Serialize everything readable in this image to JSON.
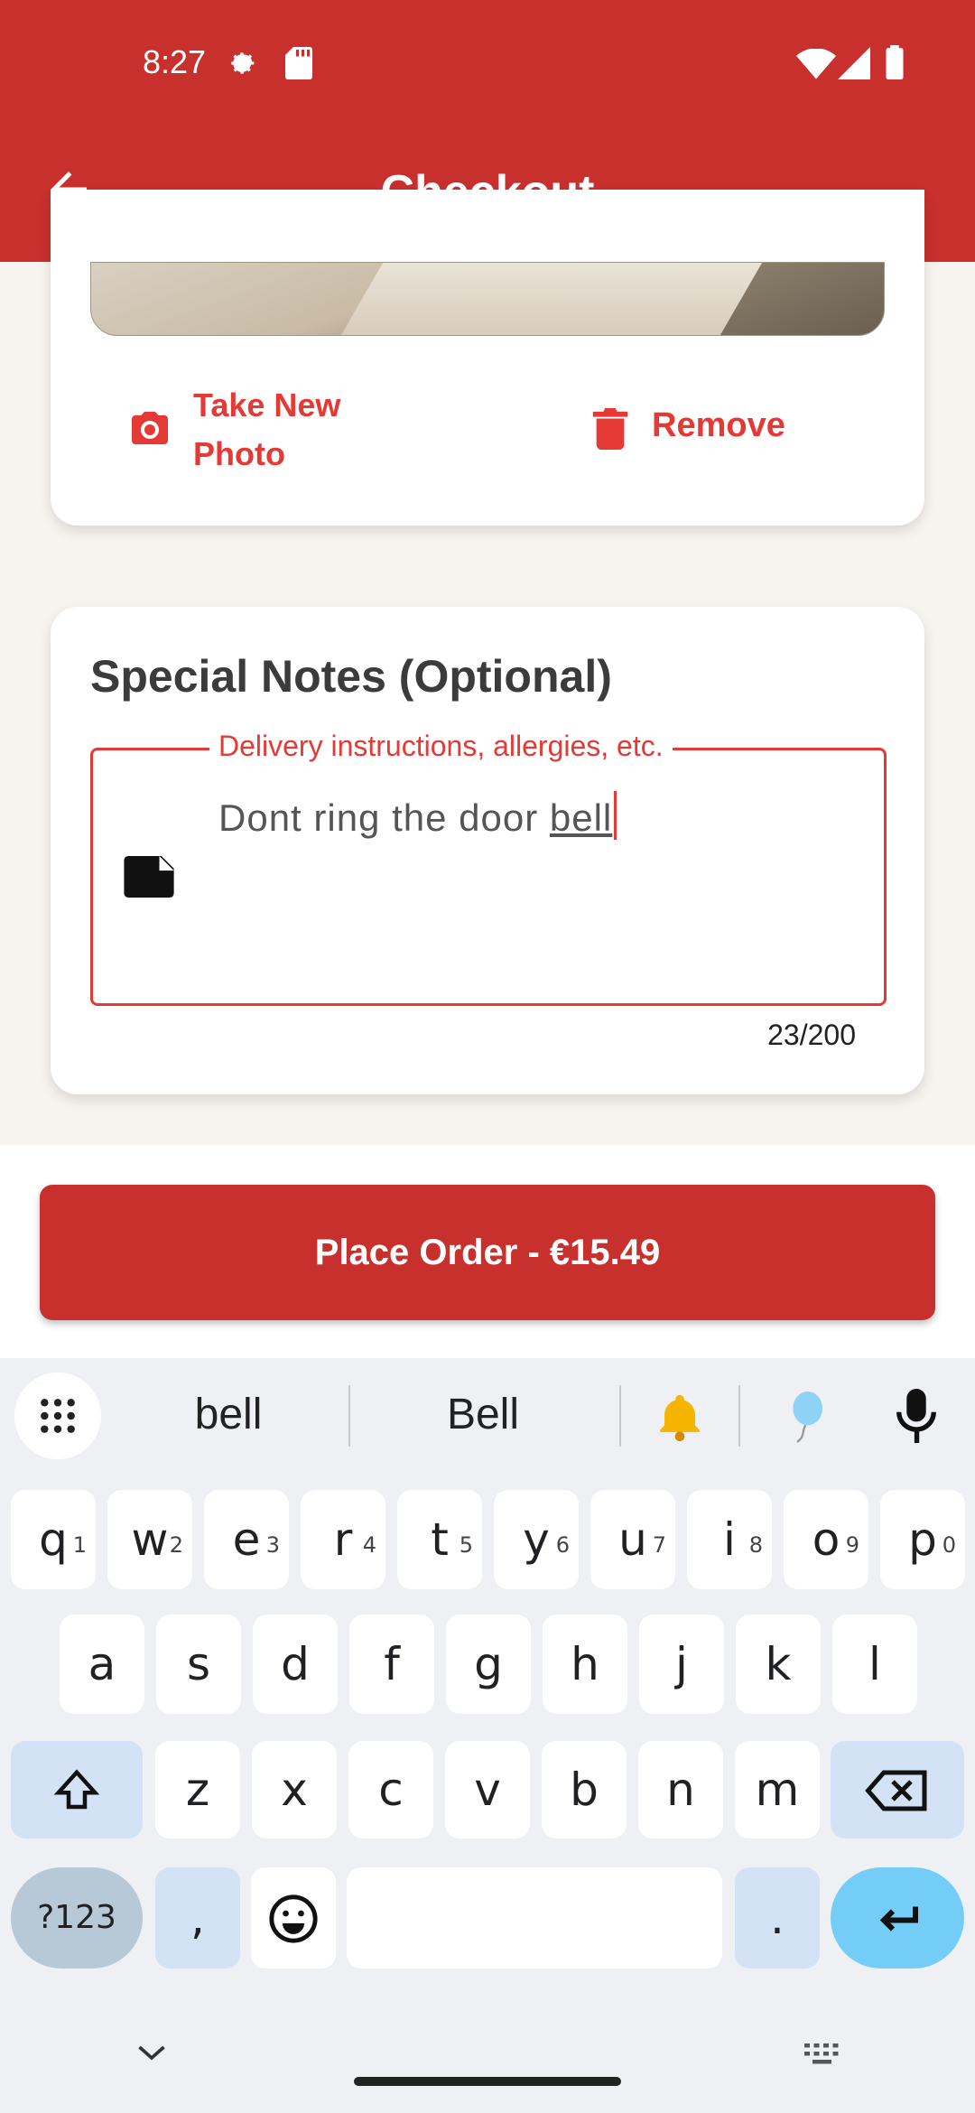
{
  "status_bar": {
    "time": "8:27"
  },
  "app_bar": {
    "title": "Checkout"
  },
  "photo_actions": {
    "take_photo": "Take New Photo",
    "remove": "Remove"
  },
  "notes": {
    "title": "Special Notes (Optional)",
    "label": "Delivery instructions, allergies, etc.",
    "value_prefix": "Dont ring the door ",
    "value_word": "bell",
    "counter": "23/200"
  },
  "order": {
    "button_label": "Place Order - €15.49"
  },
  "keyboard": {
    "suggestions": [
      "bell",
      "Bell"
    ],
    "row1": [
      {
        "k": "q",
        "n": "1"
      },
      {
        "k": "w",
        "n": "2"
      },
      {
        "k": "e",
        "n": "3"
      },
      {
        "k": "r",
        "n": "4"
      },
      {
        "k": "t",
        "n": "5"
      },
      {
        "k": "y",
        "n": "6"
      },
      {
        "k": "u",
        "n": "7"
      },
      {
        "k": "i",
        "n": "8"
      },
      {
        "k": "o",
        "n": "9"
      },
      {
        "k": "p",
        "n": "0"
      }
    ],
    "row2": [
      "a",
      "s",
      "d",
      "f",
      "g",
      "h",
      "j",
      "k",
      "l"
    ],
    "row3": [
      "z",
      "x",
      "c",
      "v",
      "b",
      "n",
      "m"
    ],
    "symbols_key": "?123",
    "comma_key": ",",
    "period_key": "."
  },
  "colors": {
    "primary": "#c8302e",
    "accent": "#e53935",
    "keyboard_bg": "#eef0f3",
    "enter_key": "#74cdf6"
  }
}
